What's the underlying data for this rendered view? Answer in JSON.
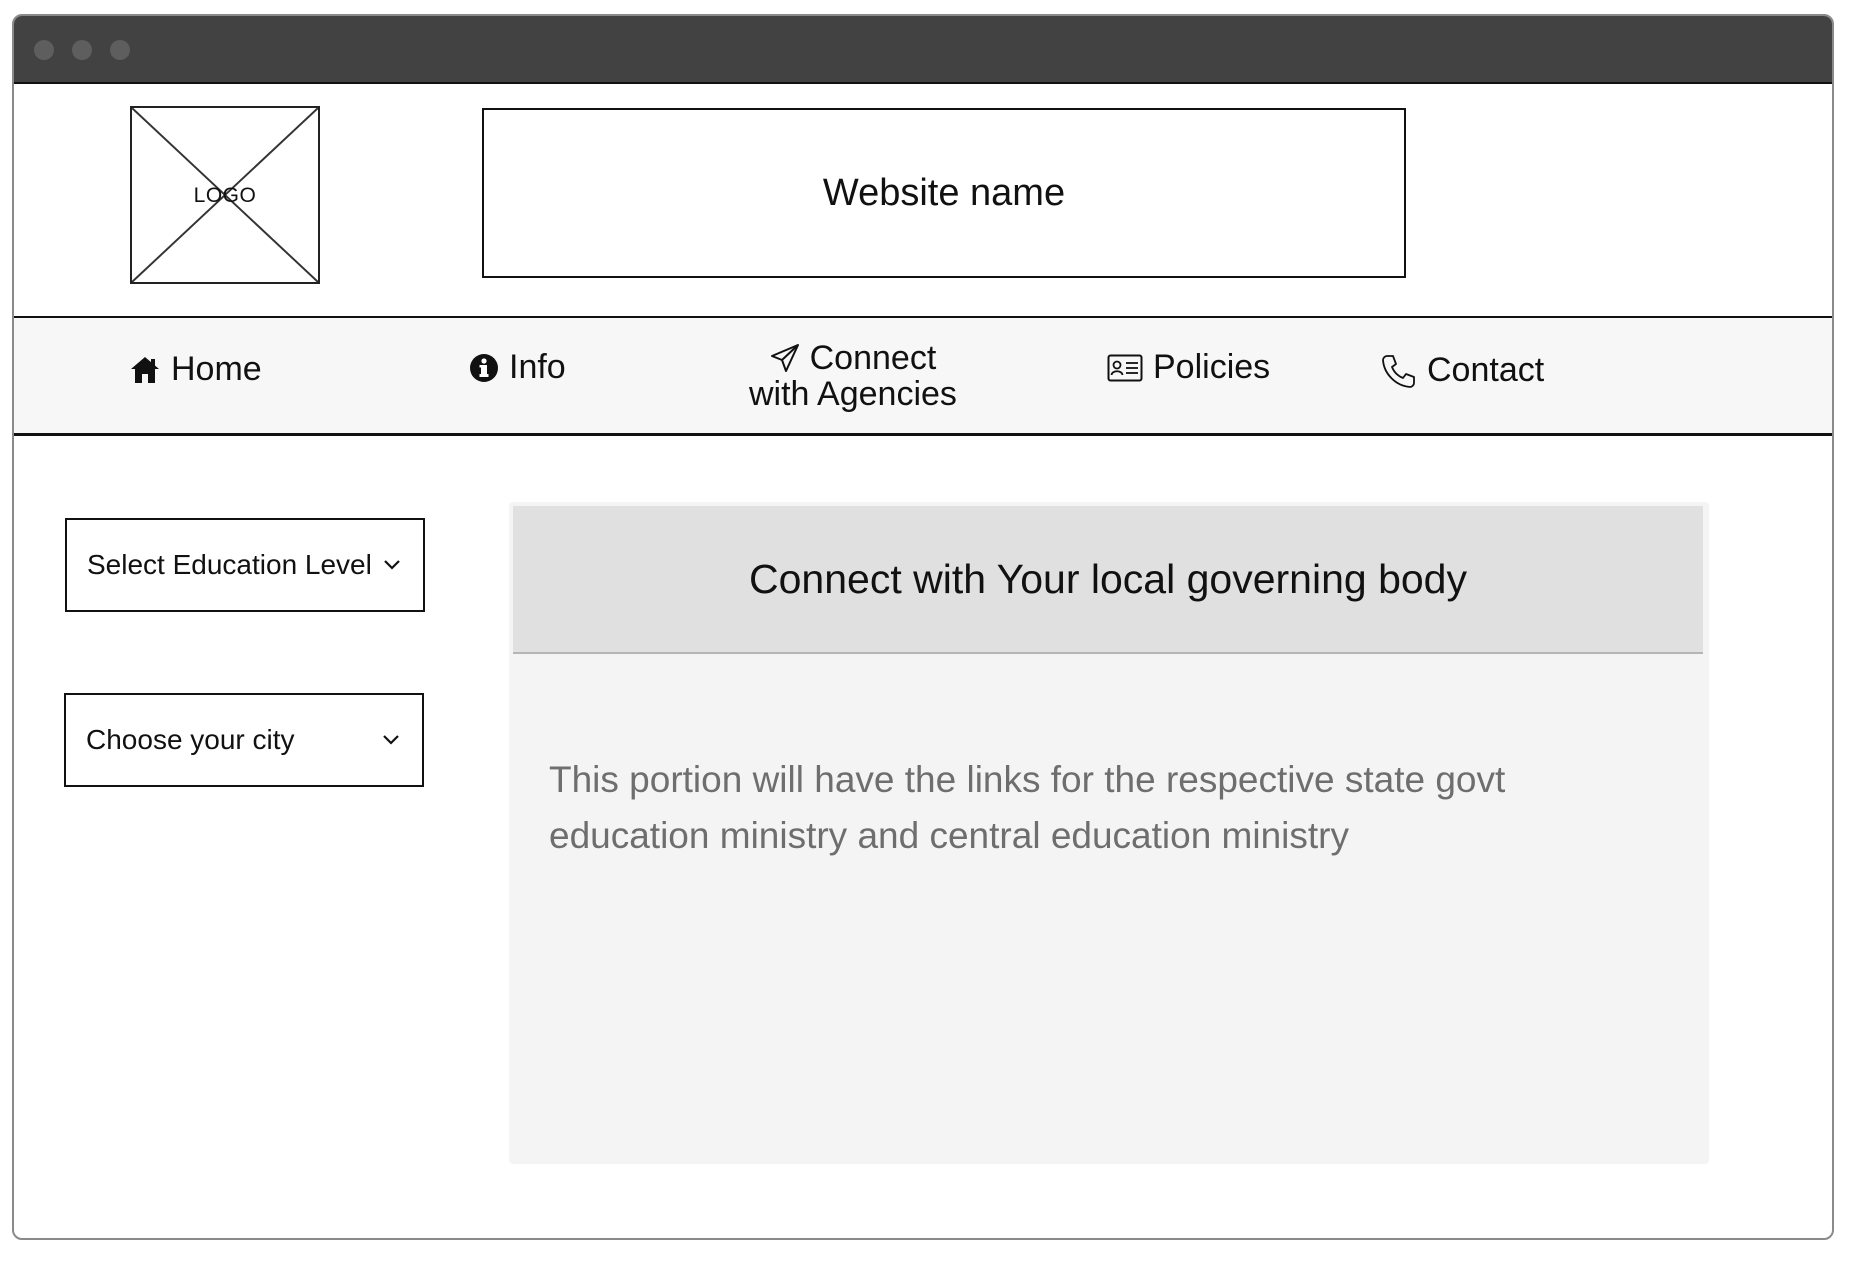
{
  "header": {
    "logo_label": "LOGO",
    "website_name": "Website name"
  },
  "nav": {
    "items": [
      {
        "label": "Home",
        "icon": "home-icon"
      },
      {
        "label": "Info",
        "icon": "info-icon"
      },
      {
        "label_line1": "Connect",
        "label_line2": "with Agencies",
        "icon": "send-icon"
      },
      {
        "label": "Policies",
        "icon": "id-card-icon"
      },
      {
        "label": "Contact",
        "icon": "phone-icon"
      }
    ]
  },
  "sidebar": {
    "education_select": {
      "value": "Select Education Level",
      "icon": "chevron-down-icon"
    },
    "city_select": {
      "value": "Choose your city",
      "icon": "chevron-down-icon"
    }
  },
  "panel": {
    "title": "Connect with Your local governing body",
    "body": "This portion will have the links for the respective state govt education ministry and central education ministry"
  },
  "colors": {
    "titlebar": "#424242",
    "nav_background": "#f7f7f7",
    "panel_background": "#f4f4f4",
    "panel_header_background": "#e0e0e0",
    "body_text": "#6e6e6e"
  }
}
